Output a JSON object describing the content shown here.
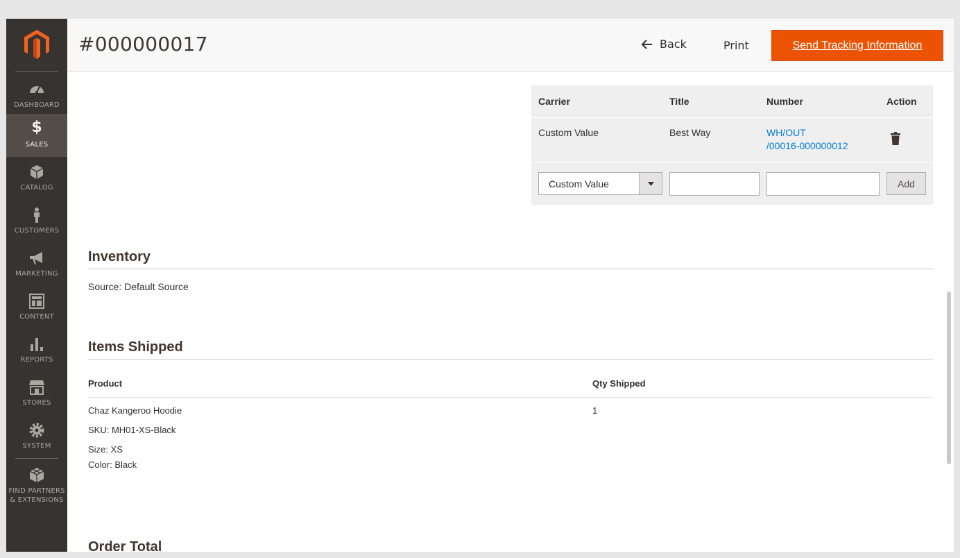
{
  "sidebar": {
    "items": [
      {
        "label": "DASHBOARD",
        "icon": "dashboard-icon"
      },
      {
        "label": "SALES",
        "icon": "dollar-icon"
      },
      {
        "label": "CATALOG",
        "icon": "box-icon"
      },
      {
        "label": "CUSTOMERS",
        "icon": "person-icon"
      },
      {
        "label": "MARKETING",
        "icon": "megaphone-icon"
      },
      {
        "label": "CONTENT",
        "icon": "layout-icon"
      },
      {
        "label": "REPORTS",
        "icon": "bar-chart-icon"
      },
      {
        "label": "STORES",
        "icon": "storefront-icon"
      },
      {
        "label": "SYSTEM",
        "icon": "gear-icon"
      },
      {
        "label_line1": "FIND PARTNERS",
        "label_line2": "& EXTENSIONS",
        "icon": "blocks-icon"
      }
    ]
  },
  "header": {
    "title": "#000000017",
    "back_label": "Back",
    "print_label": "Print",
    "send_label": "Send Tracking Information"
  },
  "tracking": {
    "headers": {
      "carrier": "Carrier",
      "title": "Title",
      "number": "Number",
      "action": "Action"
    },
    "row": {
      "carrier": "Custom Value",
      "title": "Best Way",
      "number_line1": "WH/OUT",
      "number_line2": "/00016-000000012"
    },
    "new_row": {
      "carrier_selected": "Custom Value",
      "title_value": "",
      "number_value": "",
      "add_label": "Add"
    }
  },
  "inventory": {
    "title": "Inventory",
    "source_label": "Source:",
    "source_value": "Default Source"
  },
  "items_shipped": {
    "title": "Items Shipped",
    "col_product": "Product",
    "col_qty": "Qty Shipped",
    "item": {
      "name": "Chaz Kangeroo Hoodie",
      "sku_label": "SKU:",
      "sku": "MH01-XS-Black",
      "size_label": "Size:",
      "size": "XS",
      "color_label": "Color:",
      "color": "Black",
      "qty": "1"
    }
  },
  "order_total": {
    "title": "Order Total"
  },
  "colors": {
    "accent": "#eb5202",
    "sidebar_bg": "#373330",
    "link": "#007bdb"
  }
}
